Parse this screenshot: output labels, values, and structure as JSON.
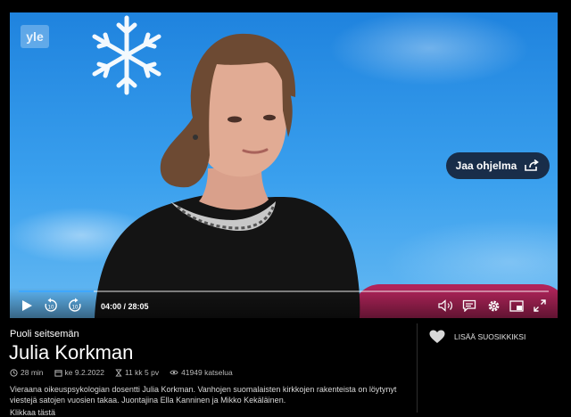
{
  "player": {
    "logo_text": "yle",
    "share_label": "Jaa ohjelma",
    "time_display": "04:00 / 28:05",
    "progress_fraction": 0.142,
    "accent": "#3fa7ff",
    "icons": {
      "play": "play-icon",
      "rewind": "rewind-10-icon",
      "forward": "forward-10-icon",
      "volume": "volume-icon",
      "subtitles": "subtitles-icon",
      "settings": "gear-icon",
      "pip": "picture-in-picture-icon",
      "fullscreen": "fullscreen-icon",
      "share": "share-icon"
    }
  },
  "program": {
    "series": "Puoli seitsemän",
    "title": "Julia Korkman",
    "meta": {
      "duration": "28 min",
      "date": "ke 9.2.2022",
      "age": "11 kk 5 pv",
      "views": "41949 katselua"
    },
    "description": "Vieraana oikeuspsykologian dosentti Julia Korkman. Vanhojen suomalaisten kirkkojen rakenteista on löytynyt viestejä satojen vuosien takaa. Juontajina Ella Kanninen ja Mikko Kekäläinen.",
    "more_label": "Klikkaa tästä"
  },
  "sidebar": {
    "favorite_label": "LISÄÄ SUOSIKKIKSI"
  }
}
